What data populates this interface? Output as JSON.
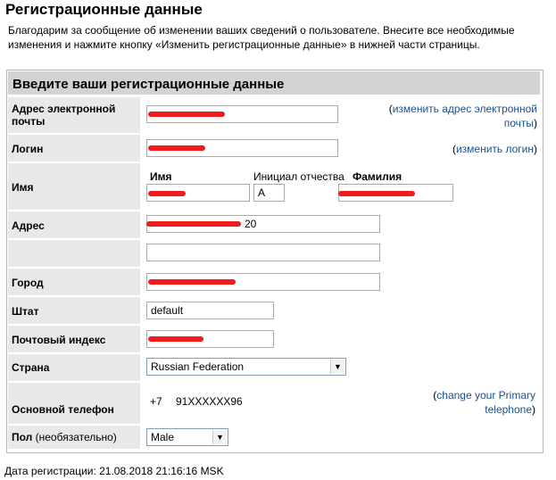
{
  "page": {
    "title": "Регистрационные данные",
    "intro": "Благодарим за сообщение об изменении ваших сведений о пользователе. Внесите все необходимые изменения и нажмите кнопку «Изменить регистрационные данные» в нижней части страницы."
  },
  "form": {
    "header": "Введите ваши регистрационные данные",
    "email": {
      "label": "Адрес электронной почты",
      "value": "",
      "link_open": "(",
      "link_text": "изменить адрес электронной почты",
      "link_close": ")"
    },
    "login": {
      "label": "Логин",
      "value": "",
      "link_open": "(",
      "link_text": "изменить логин",
      "link_close": ")"
    },
    "name": {
      "label": "Имя",
      "first_label": "Имя",
      "middle_label": "Инициал отчества",
      "last_label": "Фамилия",
      "first_value": "",
      "middle_value": "А",
      "last_value": ""
    },
    "address": {
      "label": "Адрес",
      "line1": "20",
      "line2": ""
    },
    "city": {
      "label": "Город",
      "value": ""
    },
    "state": {
      "label": "Штат",
      "value": "default"
    },
    "zip": {
      "label": "Почтовый индекс",
      "value": ""
    },
    "country": {
      "label": "Страна",
      "selected": "Russian Federation"
    },
    "phone": {
      "label": "Основной телефон",
      "code": "+7",
      "number": "91XXXXXX96",
      "link_open": "(",
      "link_text": "change your Primary telephone",
      "link_close": ")"
    },
    "gender": {
      "label": "Пол",
      "optional": "(необязательно)",
      "selected": "Male"
    }
  },
  "footer": {
    "registration_date": "Дата регистрации: 21.08.2018 21:16:16 MSK"
  },
  "colors": {
    "header_bg": "#d3d3d3",
    "label_bg": "#e8e8e8",
    "link": "#1a4f8a",
    "redaction": "#ee1c1c"
  }
}
